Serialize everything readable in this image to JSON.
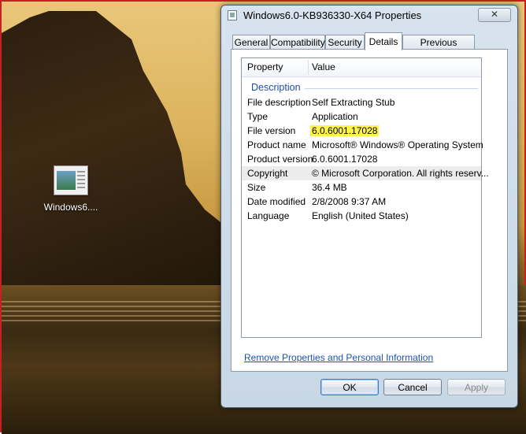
{
  "desktop": {
    "icon_label": "Windows6...."
  },
  "dialog": {
    "title": "Windows6.0-KB936330-X64 Properties",
    "close_glyph": "✕",
    "tabs": [
      {
        "label": "General"
      },
      {
        "label": "Compatibility"
      },
      {
        "label": "Security"
      },
      {
        "label": "Details",
        "active": true
      },
      {
        "label": "Previous Versions"
      }
    ],
    "list": {
      "col_property": "Property",
      "col_value": "Value",
      "group": "Description",
      "rows": [
        {
          "name": "File description",
          "value": "Self Extracting Stub"
        },
        {
          "name": "Type",
          "value": "Application"
        },
        {
          "name": "File version",
          "value": "6.0.6001.17028",
          "highlight": "#fff44a"
        },
        {
          "name": "Product name",
          "value": "Microsoft® Windows® Operating System"
        },
        {
          "name": "Product version",
          "value": "6.0.6001.17028"
        },
        {
          "name": "Copyright",
          "value": "© Microsoft Corporation. All rights reserv...",
          "selected": true
        },
        {
          "name": "Size",
          "value": "36.4 MB"
        },
        {
          "name": "Date modified",
          "value": "2/8/2008 9:37 AM"
        },
        {
          "name": "Language",
          "value": "English (United States)"
        }
      ]
    },
    "remove_link": "Remove Properties and Personal Information",
    "buttons": {
      "ok": "OK",
      "cancel": "Cancel",
      "apply": "Apply"
    }
  }
}
